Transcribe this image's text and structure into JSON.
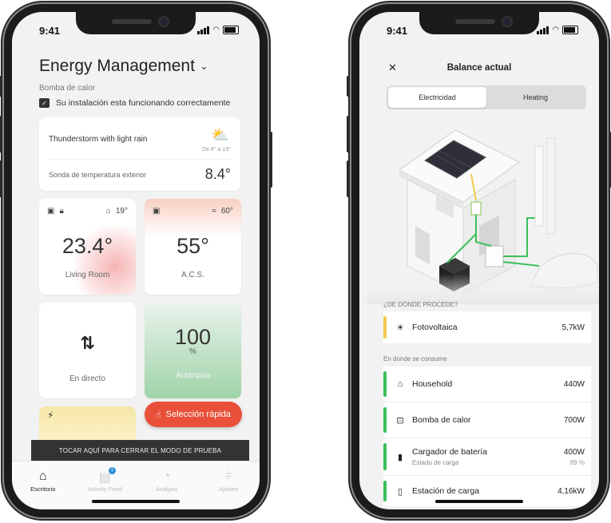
{
  "left_phone": {
    "status_time": "9:41",
    "header": {
      "title": "Energy Management",
      "subtitle": "Bomba de calor",
      "status_message": "Su instalación esta funcionando correctamente"
    },
    "weather": {
      "description": "Thunderstorm with light rain",
      "icon": "cloud-sun-rain-icon",
      "range": "De 8° a 19°",
      "sensor_label": "Sonda de temperatura exterior",
      "sensor_value": "8.4°"
    },
    "living_room": {
      "indoor_temp": "19°",
      "value": "23.4°",
      "label": "Living Room"
    },
    "acs": {
      "setpoint": "60°",
      "value": "55°",
      "label": "A.C.S."
    },
    "live": {
      "label": "En directo"
    },
    "autarky": {
      "value": "100",
      "unit": "%",
      "label": "Autarquía"
    },
    "quick_select": {
      "label": "Selección rápida"
    },
    "test_mode_banner": "TOCAR AQUÍ PARA CERRAR EL MODO DE PRUEBA",
    "tabs": [
      {
        "label": "Escritorio",
        "icon": "home-icon",
        "active": true
      },
      {
        "label": "Activity Feed",
        "icon": "feed-icon",
        "badge": "1"
      },
      {
        "label": "Analysis",
        "icon": "analysis-icon"
      },
      {
        "label": "Ajustes",
        "icon": "sliders-icon"
      }
    ]
  },
  "right_phone": {
    "status_time": "9:41",
    "title": "Balance actual",
    "segments": [
      "Electricidad",
      "Heating"
    ],
    "source_section": "¿DE DÓNDE PROCEDE?",
    "sources": [
      {
        "label": "Fotovoltaica",
        "value": "5,7kW",
        "color": "#f2c94c",
        "icon": "sun-icon"
      }
    ],
    "consume_section": "En donde se consume",
    "consumers": [
      {
        "label": "Household",
        "value": "440W",
        "color": "#3cbf5a",
        "icon": "house-icon"
      },
      {
        "label": "Bomba de calor",
        "value": "700W",
        "color": "#3cbf5a",
        "icon": "heat-pump-icon"
      },
      {
        "label": "Cargador de batería",
        "sublabel": "Estado de carga",
        "value": "400W",
        "subvalue": "89 %",
        "color": "#3cbf5a",
        "icon": "battery-icon"
      },
      {
        "label": "Estación de carga",
        "value": "4,16kW",
        "color": "#3cbf5a",
        "icon": "charging-station-icon"
      }
    ]
  }
}
